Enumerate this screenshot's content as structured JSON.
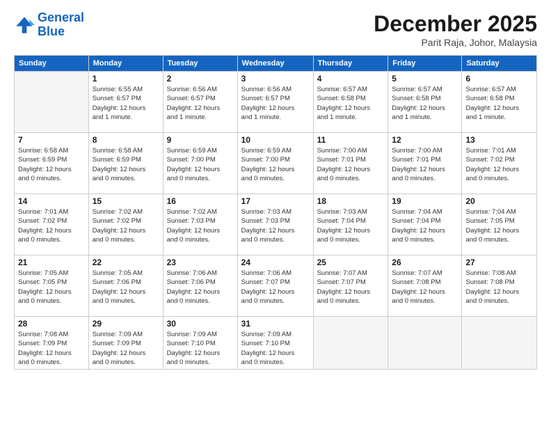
{
  "logo": {
    "line1": "General",
    "line2": "Blue"
  },
  "title": "December 2025",
  "location": "Parit Raja, Johor, Malaysia",
  "days_of_week": [
    "Sunday",
    "Monday",
    "Tuesday",
    "Wednesday",
    "Thursday",
    "Friday",
    "Saturday"
  ],
  "weeks": [
    [
      {
        "day": "",
        "info": ""
      },
      {
        "day": "1",
        "info": "Sunrise: 6:55 AM\nSunset: 6:57 PM\nDaylight: 12 hours\nand 1 minute."
      },
      {
        "day": "2",
        "info": "Sunrise: 6:56 AM\nSunset: 6:57 PM\nDaylight: 12 hours\nand 1 minute."
      },
      {
        "day": "3",
        "info": "Sunrise: 6:56 AM\nSunset: 6:57 PM\nDaylight: 12 hours\nand 1 minute."
      },
      {
        "day": "4",
        "info": "Sunrise: 6:57 AM\nSunset: 6:58 PM\nDaylight: 12 hours\nand 1 minute."
      },
      {
        "day": "5",
        "info": "Sunrise: 6:57 AM\nSunset: 6:58 PM\nDaylight: 12 hours\nand 1 minute."
      },
      {
        "day": "6",
        "info": "Sunrise: 6:57 AM\nSunset: 6:58 PM\nDaylight: 12 hours\nand 1 minute."
      }
    ],
    [
      {
        "day": "7",
        "info": "Sunrise: 6:58 AM\nSunset: 6:59 PM\nDaylight: 12 hours\nand 0 minutes."
      },
      {
        "day": "8",
        "info": "Sunrise: 6:58 AM\nSunset: 6:59 PM\nDaylight: 12 hours\nand 0 minutes."
      },
      {
        "day": "9",
        "info": "Sunrise: 6:59 AM\nSunset: 7:00 PM\nDaylight: 12 hours\nand 0 minutes."
      },
      {
        "day": "10",
        "info": "Sunrise: 6:59 AM\nSunset: 7:00 PM\nDaylight: 12 hours\nand 0 minutes."
      },
      {
        "day": "11",
        "info": "Sunrise: 7:00 AM\nSunset: 7:01 PM\nDaylight: 12 hours\nand 0 minutes."
      },
      {
        "day": "12",
        "info": "Sunrise: 7:00 AM\nSunset: 7:01 PM\nDaylight: 12 hours\nand 0 minutes."
      },
      {
        "day": "13",
        "info": "Sunrise: 7:01 AM\nSunset: 7:02 PM\nDaylight: 12 hours\nand 0 minutes."
      }
    ],
    [
      {
        "day": "14",
        "info": "Sunrise: 7:01 AM\nSunset: 7:02 PM\nDaylight: 12 hours\nand 0 minutes."
      },
      {
        "day": "15",
        "info": "Sunrise: 7:02 AM\nSunset: 7:02 PM\nDaylight: 12 hours\nand 0 minutes."
      },
      {
        "day": "16",
        "info": "Sunrise: 7:02 AM\nSunset: 7:03 PM\nDaylight: 12 hours\nand 0 minutes."
      },
      {
        "day": "17",
        "info": "Sunrise: 7:03 AM\nSunset: 7:03 PM\nDaylight: 12 hours\nand 0 minutes."
      },
      {
        "day": "18",
        "info": "Sunrise: 7:03 AM\nSunset: 7:04 PM\nDaylight: 12 hours\nand 0 minutes."
      },
      {
        "day": "19",
        "info": "Sunrise: 7:04 AM\nSunset: 7:04 PM\nDaylight: 12 hours\nand 0 minutes."
      },
      {
        "day": "20",
        "info": "Sunrise: 7:04 AM\nSunset: 7:05 PM\nDaylight: 12 hours\nand 0 minutes."
      }
    ],
    [
      {
        "day": "21",
        "info": "Sunrise: 7:05 AM\nSunset: 7:05 PM\nDaylight: 12 hours\nand 0 minutes."
      },
      {
        "day": "22",
        "info": "Sunrise: 7:05 AM\nSunset: 7:06 PM\nDaylight: 12 hours\nand 0 minutes."
      },
      {
        "day": "23",
        "info": "Sunrise: 7:06 AM\nSunset: 7:06 PM\nDaylight: 12 hours\nand 0 minutes."
      },
      {
        "day": "24",
        "info": "Sunrise: 7:06 AM\nSunset: 7:07 PM\nDaylight: 12 hours\nand 0 minutes."
      },
      {
        "day": "25",
        "info": "Sunrise: 7:07 AM\nSunset: 7:07 PM\nDaylight: 12 hours\nand 0 minutes."
      },
      {
        "day": "26",
        "info": "Sunrise: 7:07 AM\nSunset: 7:08 PM\nDaylight: 12 hours\nand 0 minutes."
      },
      {
        "day": "27",
        "info": "Sunrise: 7:08 AM\nSunset: 7:08 PM\nDaylight: 12 hours\nand 0 minutes."
      }
    ],
    [
      {
        "day": "28",
        "info": "Sunrise: 7:08 AM\nSunset: 7:09 PM\nDaylight: 12 hours\nand 0 minutes."
      },
      {
        "day": "29",
        "info": "Sunrise: 7:09 AM\nSunset: 7:09 PM\nDaylight: 12 hours\nand 0 minutes."
      },
      {
        "day": "30",
        "info": "Sunrise: 7:09 AM\nSunset: 7:10 PM\nDaylight: 12 hours\nand 0 minutes."
      },
      {
        "day": "31",
        "info": "Sunrise: 7:09 AM\nSunset: 7:10 PM\nDaylight: 12 hours\nand 0 minutes."
      },
      {
        "day": "",
        "info": ""
      },
      {
        "day": "",
        "info": ""
      },
      {
        "day": "",
        "info": ""
      }
    ]
  ]
}
